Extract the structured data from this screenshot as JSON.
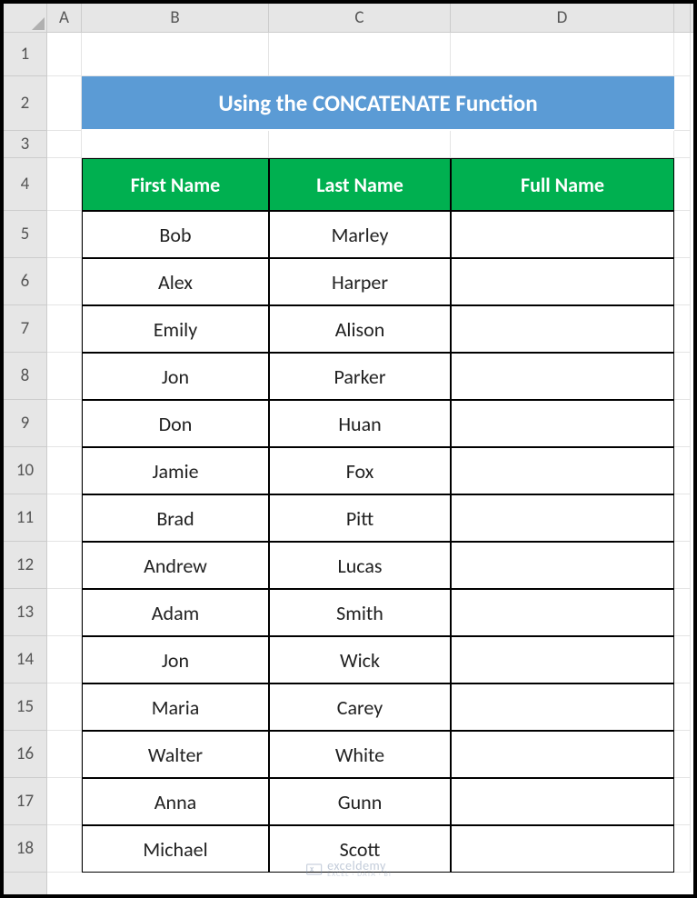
{
  "columns": [
    "A",
    "B",
    "C",
    "D"
  ],
  "rows": [
    1,
    2,
    3,
    4,
    5,
    6,
    7,
    8,
    9,
    10,
    11,
    12,
    13,
    14,
    15,
    16,
    17,
    18
  ],
  "title": "Using the CONCATENATE Function",
  "table": {
    "headers": {
      "first": "First Name",
      "last": "Last Name",
      "full": "Full Name"
    },
    "data": [
      {
        "first": "Bob",
        "last": "Marley",
        "full": ""
      },
      {
        "first": "Alex",
        "last": "Harper",
        "full": ""
      },
      {
        "first": "Emily",
        "last": "Alison",
        "full": ""
      },
      {
        "first": "Jon",
        "last": "Parker",
        "full": ""
      },
      {
        "first": "Don",
        "last": "Huan",
        "full": ""
      },
      {
        "first": "Jamie",
        "last": "Fox",
        "full": ""
      },
      {
        "first": "Brad",
        "last": "Pitt",
        "full": ""
      },
      {
        "first": "Andrew",
        "last": "Lucas",
        "full": ""
      },
      {
        "first": "Adam",
        "last": "Smith",
        "full": ""
      },
      {
        "first": "Jon",
        "last": "Wick",
        "full": ""
      },
      {
        "first": "Maria",
        "last": "Carey",
        "full": ""
      },
      {
        "first": "Walter",
        "last": "White",
        "full": ""
      },
      {
        "first": "Anna",
        "last": "Gunn",
        "full": ""
      },
      {
        "first": "Michael",
        "last": "Scott",
        "full": ""
      }
    ]
  },
  "watermark": {
    "brand": "exceldemy",
    "sub": "EXCEL · DATA · BI"
  },
  "colors": {
    "banner": "#5B9BD5",
    "header": "#00B050"
  }
}
